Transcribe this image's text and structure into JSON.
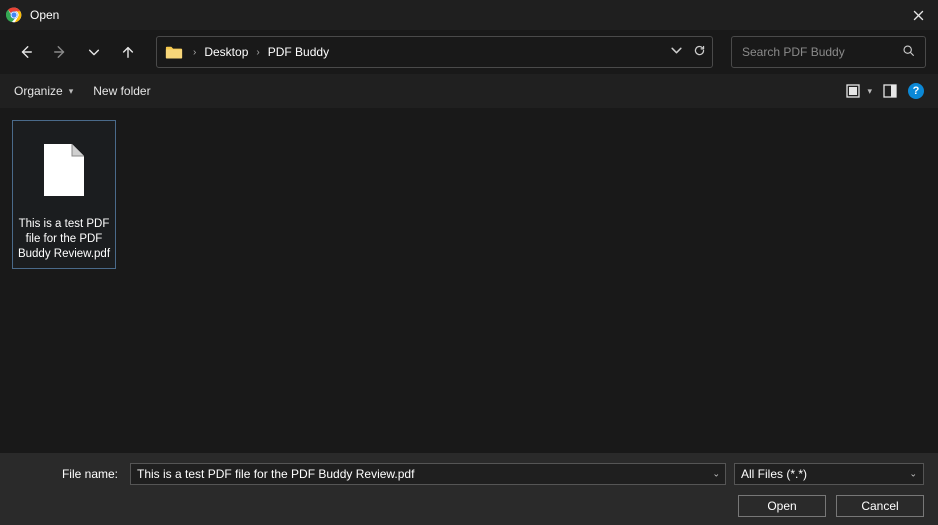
{
  "titlebar": {
    "title": "Open"
  },
  "nav": {
    "breadcrumbs": [
      "Desktop",
      "PDF Buddy"
    ]
  },
  "search": {
    "placeholder": "Search PDF Buddy"
  },
  "toolbar": {
    "organize": "Organize",
    "new_folder": "New folder"
  },
  "files": [
    {
      "name": "This is a test PDF file for the PDF Buddy Review.pdf"
    }
  ],
  "bottom": {
    "filename_label": "File name:",
    "filename_value": "This is a test PDF file for the PDF Buddy Review.pdf",
    "filetype": "All Files (*.*)",
    "open_label": "Open",
    "cancel_label": "Cancel"
  }
}
